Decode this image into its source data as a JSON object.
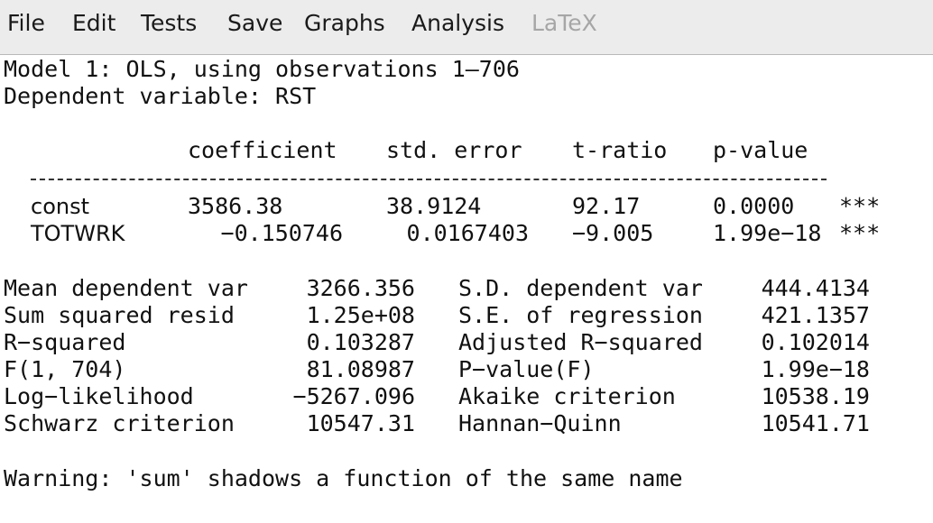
{
  "menu": {
    "items": [
      {
        "label": "File",
        "enabled": true
      },
      {
        "label": "Edit",
        "enabled": true
      },
      {
        "label": "Tests",
        "enabled": true
      },
      {
        "label": "Save",
        "enabled": true
      },
      {
        "label": "Graphs",
        "enabled": true
      },
      {
        "label": "Analysis",
        "enabled": true
      },
      {
        "label": "LaTeX",
        "enabled": false
      }
    ]
  },
  "model": {
    "title": "Model 1: OLS, using observations 1–706",
    "dependent": "Dependent variable: RST"
  },
  "coef_table": {
    "headers": [
      "coefficient",
      "std. error",
      "t-ratio",
      "p-value"
    ],
    "rows": [
      {
        "name": "const",
        "coefficient": "3586.38",
        "std_error": "38.9124",
        "t_ratio": "92.17",
        "p_value": "0.0000",
        "stars": "***"
      },
      {
        "name": "TOTWRK",
        "coefficient": "−0.150746",
        "std_error": "0.0167403",
        "t_ratio": "−9.005",
        "p_value": "1.99e−18",
        "stars": "***"
      }
    ]
  },
  "stats": [
    {
      "label1": "Mean dependent var",
      "value1": "3266.356",
      "label2": "S.D. dependent var",
      "value2": "444.4134"
    },
    {
      "label1": "Sum squared resid",
      "value1": "1.25e+08",
      "label2": "S.E. of regression",
      "value2": "421.1357"
    },
    {
      "label1": "R−squared",
      "value1": "0.103287",
      "label2": "Adjusted R−squared",
      "value2": "0.102014"
    },
    {
      "label1": "F(1, 704)",
      "value1": "81.08987",
      "label2": "P−value(F)",
      "value2": "1.99e−18"
    },
    {
      "label1": "Log−likelihood",
      "value1": "−5267.096",
      "label2": "Akaike criterion",
      "value2": "10538.19"
    },
    {
      "label1": "Schwarz criterion",
      "value1": "10547.31",
      "label2": "Hannan−Quinn",
      "value2": "10541.71"
    }
  ],
  "warning": "Warning: 'sum' shadows a function of the same name"
}
